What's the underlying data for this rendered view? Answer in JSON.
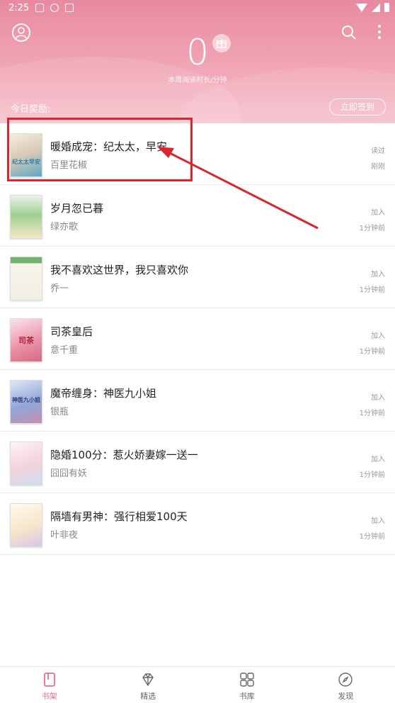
{
  "status_bar": {
    "time": "2:25"
  },
  "header": {
    "reading_minutes": "0",
    "reading_label": "本周阅读时长/分钟",
    "reward_label": "今日奖励:",
    "signin_label": "立即签到"
  },
  "books": [
    {
      "title": "暖婚成宠：纪太太，早安",
      "author": "百里花椒",
      "status": "读过",
      "time": "刚刚",
      "cover_color": "#5aa9c9",
      "cover_text": "纪太太早安"
    },
    {
      "title": "岁月忽已暮",
      "author": "绿亦歌",
      "status": "加入",
      "time": "1分钟前",
      "cover_color": "#9fcf8f",
      "cover_text": ""
    },
    {
      "title": "我不喜欢这世界，我只喜欢你",
      "author": "乔一",
      "status": "加入",
      "time": "1分钟前",
      "cover_color": "#f2efe4",
      "cover_text": ""
    },
    {
      "title": "司茶皇后",
      "author": "意千重",
      "status": "加入",
      "time": "1分钟前",
      "cover_color": "#e98fa5",
      "cover_text": "司茶"
    },
    {
      "title": "魔帝缠身：神医九小姐",
      "author": "银瓶",
      "status": "加入",
      "time": "1分钟前",
      "cover_color": "#8fa7d8",
      "cover_text": "神医九小姐"
    },
    {
      "title": "隐婚100分：惹火娇妻嫁一送一",
      "author": "囧囧有妖",
      "status": "加入",
      "time": "1分钟前",
      "cover_color": "#f3d2dc",
      "cover_text": ""
    },
    {
      "title": "隔墙有男神：强行相爱100天",
      "author": "叶非夜",
      "status": "加入",
      "time": "1分钟前",
      "cover_color": "#f7e6c8",
      "cover_text": ""
    }
  ],
  "tabs": [
    {
      "label": "书架",
      "icon": "bookshelf-icon",
      "active": true
    },
    {
      "label": "精选",
      "icon": "diamond-icon",
      "active": false
    },
    {
      "label": "书库",
      "icon": "grid-icon",
      "active": false
    },
    {
      "label": "发现",
      "icon": "compass-icon",
      "active": false
    }
  ],
  "colors": {
    "accent": "#ef6b8a",
    "header": "#e88aa0",
    "annotation": "#d9262c"
  }
}
